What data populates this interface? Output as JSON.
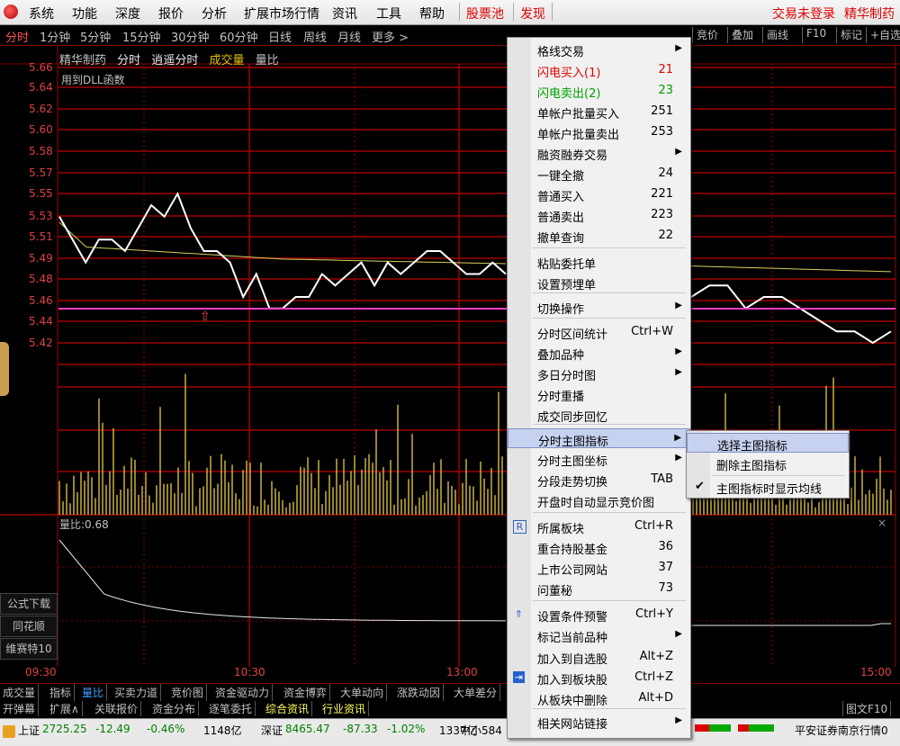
{
  "menubar": {
    "items": [
      "系统",
      "功能",
      "深度",
      "报价",
      "分析",
      "扩展市场行情",
      "资讯",
      "工具",
      "帮助"
    ],
    "stock_pool": "股票池",
    "discover": "发现",
    "login_status": "交易未登录",
    "stock_name": "精华制药"
  },
  "periodbar": {
    "periods": [
      "分时",
      "1分钟",
      "5分钟",
      "15分钟",
      "30分钟",
      "60分钟",
      "日线",
      "周线",
      "月线",
      "更多 >"
    ],
    "active_index": 0,
    "tools": [
      "竞价",
      "叠加",
      "画线",
      "F10",
      "标记",
      "+自选"
    ]
  },
  "chart": {
    "header": {
      "name": "精华制药",
      "mode": "分时",
      "window": "逍遥分时",
      "volume": "成交量",
      "ratio": "量比"
    },
    "note": "用到DLL函数",
    "y_labels": [
      "5.66",
      "5.64",
      "5.62",
      "5.60",
      "5.58",
      "5.57",
      "5.55",
      "5.53",
      "5.51",
      "5.49",
      "5.48",
      "5.46",
      "5.44",
      "5.42"
    ],
    "ratio_label": "量比:0.68",
    "time_labels": [
      "09:30",
      "10:30",
      "13:00",
      "15:00"
    ],
    "side_buttons": [
      "公式下载",
      "同花顺",
      "维赛特10"
    ],
    "close_x": "×"
  },
  "chart_data": {
    "type": "line",
    "price_ylim": [
      5.42,
      5.66
    ],
    "price_series_start": [
      5.53,
      5.51,
      5.49,
      5.51,
      5.51,
      5.5,
      5.52,
      5.54,
      5.53,
      5.55,
      5.52,
      5.5,
      5.5,
      5.49,
      5.46,
      5.48,
      5.45,
      5.45,
      5.46,
      5.46,
      5.48,
      5.47,
      5.48,
      5.49,
      5.47,
      5.49,
      5.48,
      5.49,
      5.5,
      5.5,
      5.49,
      5.48,
      5.48,
      5.49,
      5.48
    ],
    "price_series_end": [
      5.46,
      5.47,
      5.47,
      5.45,
      5.46,
      5.46,
      5.45,
      5.44,
      5.43,
      5.43,
      5.42,
      5.43
    ],
    "prev_close": 5.455
  },
  "tabs_row1": [
    "成交量",
    "指标",
    "量比",
    "买卖力道",
    "竞价图",
    "资金驱动力",
    "资金博弈",
    "大单动向",
    "涨跌动因",
    "大单差分"
  ],
  "tabs_row1_active": 2,
  "tabs_row2": [
    "开弹幕",
    "扩展∧",
    "关联报价",
    "资金分布",
    "逐笔委托",
    "综合资讯",
    "行业资讯"
  ],
  "tabs_row2_active": [
    5,
    6
  ],
  "tab_f10": "图文F10",
  "status": {
    "sh_label": "上证",
    "sh_value": "2725.25",
    "sh_change": "-12.49",
    "sh_pct": "-0.46%",
    "sh_amount": "1148亿",
    "sz_label": "深证",
    "sz_value": "8465.47",
    "sz_change": "-87.33",
    "sz_pct": "-1.02%",
    "sz_amount": "1337亿",
    "sme_label": "中小584",
    "broker": "平安证券南京行情0"
  },
  "context_menu": {
    "items": [
      {
        "label": "格线交易",
        "shortcut": "",
        "submenu": true
      },
      {
        "label": "闪电买入(1)",
        "shortcut": "21",
        "color": "red"
      },
      {
        "label": "闪电卖出(2)",
        "shortcut": "23",
        "color": "green"
      },
      {
        "label": "单帐户批量买入",
        "shortcut": "251"
      },
      {
        "label": "单帐户批量卖出",
        "shortcut": "253"
      },
      {
        "label": "融资融券交易",
        "shortcut": "",
        "submenu": true
      },
      {
        "label": "一键全撤",
        "shortcut": "24"
      },
      {
        "label": "普通买入",
        "shortcut": "221"
      },
      {
        "label": "普通卖出",
        "shortcut": "223"
      },
      {
        "label": "撤单查询",
        "shortcut": "22"
      },
      {
        "label": "粘贴委托单",
        "shortcut": ""
      },
      {
        "label": "设置预埋单",
        "shortcut": ""
      },
      {
        "label": "切换操作",
        "shortcut": "",
        "submenu": true
      },
      {
        "label": "分时区间统计",
        "shortcut": "Ctrl+W"
      },
      {
        "label": "叠加品种",
        "shortcut": "",
        "submenu": true
      },
      {
        "label": "多日分时图",
        "shortcut": "",
        "submenu": true
      },
      {
        "label": "分时重播",
        "shortcut": ""
      },
      {
        "label": "成交同步回忆",
        "shortcut": ""
      },
      {
        "label": "分时主图指标",
        "shortcut": "",
        "submenu": true,
        "highlighted": true
      },
      {
        "label": "分时主图坐标",
        "shortcut": "",
        "submenu": true
      },
      {
        "label": "分段走势切换",
        "shortcut": "TAB"
      },
      {
        "label": "开盘时自动显示竞价图",
        "shortcut": ""
      },
      {
        "label": "所属板块",
        "shortcut": "Ctrl+R",
        "icon": "R"
      },
      {
        "label": "重合持股基金",
        "shortcut": "36"
      },
      {
        "label": "上市公司网站",
        "shortcut": "37"
      },
      {
        "label": "问董秘",
        "shortcut": "73"
      },
      {
        "label": "设置条件预警",
        "shortcut": "Ctrl+Y",
        "icon": "alert"
      },
      {
        "label": "标记当前品种",
        "shortcut": "",
        "submenu": true
      },
      {
        "label": "加入到自选股",
        "shortcut": "Alt+Z"
      },
      {
        "label": "加入到板块股",
        "shortcut": "Ctrl+Z",
        "icon": "add"
      },
      {
        "label": "从板块中删除",
        "shortcut": "Alt+D"
      },
      {
        "label": "相关网站链接",
        "shortcut": "",
        "submenu": true
      }
    ]
  },
  "submenu": {
    "items": [
      {
        "label": "选择主图指标",
        "highlighted": true
      },
      {
        "label": "删除主图指标"
      },
      {
        "label": "主图指标时显示均线",
        "checked": true
      }
    ]
  }
}
